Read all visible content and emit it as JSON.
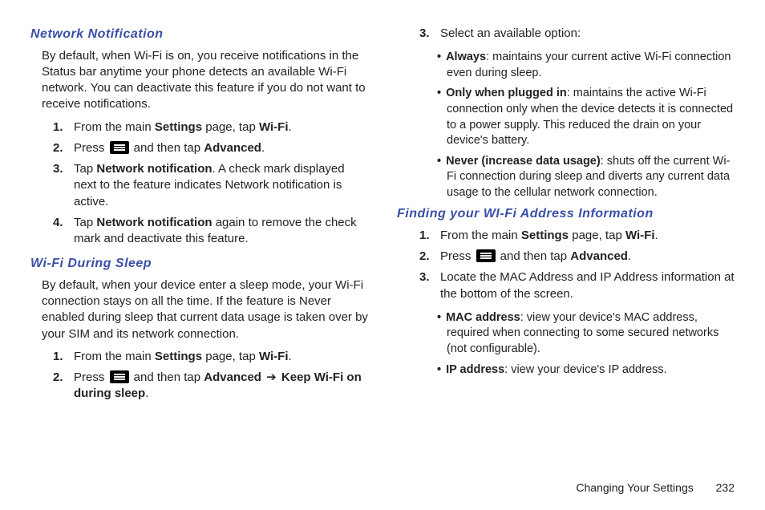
{
  "left": {
    "networkNotification": {
      "heading": "Network Notification",
      "intro": "By default, when Wi-Fi is on, you receive notifications in the Status bar anytime your phone detects an available Wi-Fi network. You can deactivate this feature if you do not want to receive notifications.",
      "steps": {
        "s1a": "From the main ",
        "s1b": "Settings",
        "s1c": " page, tap ",
        "s1d": "Wi-Fi",
        "s1e": ".",
        "s2a": "Press ",
        "s2b": " and then tap ",
        "s2c": "Advanced",
        "s2d": ".",
        "s3a": "Tap ",
        "s3b": "Network notification",
        "s3c": ". A check mark displayed next to the feature indicates Network notification is active.",
        "s4a": "Tap ",
        "s4b": "Network notification",
        "s4c": " again to remove the check mark and deactivate this feature."
      }
    },
    "wifiSleep": {
      "heading": "Wi-Fi During Sleep",
      "intro": "By default, when your device enter a sleep mode, your Wi-Fi connection stays on all the time. If the feature is Never enabled during sleep that current data usage is taken over by your SIM and its network connection.",
      "steps": {
        "s1a": "From the main ",
        "s1b": "Settings",
        "s1c": " page, tap ",
        "s1d": "Wi-Fi",
        "s1e": ".",
        "s2a": "Press ",
        "s2b": " and then tap ",
        "s2c": "Advanced",
        "s2d": " ",
        "arrow": "➔",
        "s2e": " ",
        "s2f": "Keep Wi-Fi on during sleep",
        "s2g": "."
      }
    }
  },
  "right": {
    "continuation": {
      "step3text": "Select an available option:",
      "options": {
        "o1a": "Always",
        "o1b": ": maintains your current active Wi-Fi connection even during sleep.",
        "o2a": "Only when plugged in",
        "o2b": ": maintains the active Wi-Fi connection only when the device detects it is connected to a power supply. This reduced the drain on your device's battery.",
        "o3a": "Never (increase data usage)",
        "o3b": ": shuts off the current Wi-Fi connection during sleep and diverts any current data usage to the cellular network connection."
      }
    },
    "findAddress": {
      "heading": "Finding your WI-Fi Address Information",
      "steps": {
        "s1a": "From the main ",
        "s1b": "Settings",
        "s1c": " page, tap ",
        "s1d": "Wi-Fi",
        "s1e": ".",
        "s2a": "Press ",
        "s2b": " and then tap ",
        "s2c": "Advanced",
        "s2d": ".",
        "s3a": "Locate the MAC Address and IP Address information at the bottom of the screen."
      },
      "bullets": {
        "b1a": "MAC address",
        "b1b": ": view your device's MAC address, required when connecting to some secured networks (not configurable).",
        "b2a": "IP address",
        "b2b": ": view your device's IP address."
      }
    }
  },
  "footer": {
    "title": "Changing Your Settings",
    "pageNum": "232"
  }
}
